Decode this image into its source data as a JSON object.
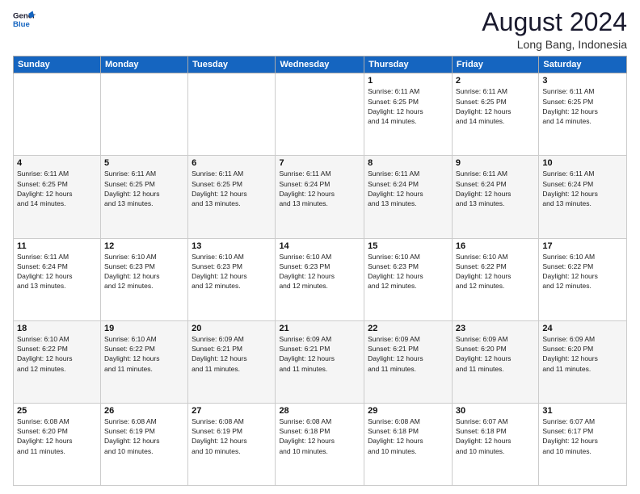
{
  "header": {
    "logo_line1": "General",
    "logo_line2": "Blue",
    "month_year": "August 2024",
    "location": "Long Bang, Indonesia"
  },
  "weekdays": [
    "Sunday",
    "Monday",
    "Tuesday",
    "Wednesday",
    "Thursday",
    "Friday",
    "Saturday"
  ],
  "weeks": [
    [
      {
        "day": "",
        "info": ""
      },
      {
        "day": "",
        "info": ""
      },
      {
        "day": "",
        "info": ""
      },
      {
        "day": "",
        "info": ""
      },
      {
        "day": "1",
        "info": "Sunrise: 6:11 AM\nSunset: 6:25 PM\nDaylight: 12 hours\nand 14 minutes."
      },
      {
        "day": "2",
        "info": "Sunrise: 6:11 AM\nSunset: 6:25 PM\nDaylight: 12 hours\nand 14 minutes."
      },
      {
        "day": "3",
        "info": "Sunrise: 6:11 AM\nSunset: 6:25 PM\nDaylight: 12 hours\nand 14 minutes."
      }
    ],
    [
      {
        "day": "4",
        "info": "Sunrise: 6:11 AM\nSunset: 6:25 PM\nDaylight: 12 hours\nand 14 minutes."
      },
      {
        "day": "5",
        "info": "Sunrise: 6:11 AM\nSunset: 6:25 PM\nDaylight: 12 hours\nand 13 minutes."
      },
      {
        "day": "6",
        "info": "Sunrise: 6:11 AM\nSunset: 6:25 PM\nDaylight: 12 hours\nand 13 minutes."
      },
      {
        "day": "7",
        "info": "Sunrise: 6:11 AM\nSunset: 6:24 PM\nDaylight: 12 hours\nand 13 minutes."
      },
      {
        "day": "8",
        "info": "Sunrise: 6:11 AM\nSunset: 6:24 PM\nDaylight: 12 hours\nand 13 minutes."
      },
      {
        "day": "9",
        "info": "Sunrise: 6:11 AM\nSunset: 6:24 PM\nDaylight: 12 hours\nand 13 minutes."
      },
      {
        "day": "10",
        "info": "Sunrise: 6:11 AM\nSunset: 6:24 PM\nDaylight: 12 hours\nand 13 minutes."
      }
    ],
    [
      {
        "day": "11",
        "info": "Sunrise: 6:11 AM\nSunset: 6:24 PM\nDaylight: 12 hours\nand 13 minutes."
      },
      {
        "day": "12",
        "info": "Sunrise: 6:10 AM\nSunset: 6:23 PM\nDaylight: 12 hours\nand 12 minutes."
      },
      {
        "day": "13",
        "info": "Sunrise: 6:10 AM\nSunset: 6:23 PM\nDaylight: 12 hours\nand 12 minutes."
      },
      {
        "day": "14",
        "info": "Sunrise: 6:10 AM\nSunset: 6:23 PM\nDaylight: 12 hours\nand 12 minutes."
      },
      {
        "day": "15",
        "info": "Sunrise: 6:10 AM\nSunset: 6:23 PM\nDaylight: 12 hours\nand 12 minutes."
      },
      {
        "day": "16",
        "info": "Sunrise: 6:10 AM\nSunset: 6:22 PM\nDaylight: 12 hours\nand 12 minutes."
      },
      {
        "day": "17",
        "info": "Sunrise: 6:10 AM\nSunset: 6:22 PM\nDaylight: 12 hours\nand 12 minutes."
      }
    ],
    [
      {
        "day": "18",
        "info": "Sunrise: 6:10 AM\nSunset: 6:22 PM\nDaylight: 12 hours\nand 12 minutes."
      },
      {
        "day": "19",
        "info": "Sunrise: 6:10 AM\nSunset: 6:22 PM\nDaylight: 12 hours\nand 11 minutes."
      },
      {
        "day": "20",
        "info": "Sunrise: 6:09 AM\nSunset: 6:21 PM\nDaylight: 12 hours\nand 11 minutes."
      },
      {
        "day": "21",
        "info": "Sunrise: 6:09 AM\nSunset: 6:21 PM\nDaylight: 12 hours\nand 11 minutes."
      },
      {
        "day": "22",
        "info": "Sunrise: 6:09 AM\nSunset: 6:21 PM\nDaylight: 12 hours\nand 11 minutes."
      },
      {
        "day": "23",
        "info": "Sunrise: 6:09 AM\nSunset: 6:20 PM\nDaylight: 12 hours\nand 11 minutes."
      },
      {
        "day": "24",
        "info": "Sunrise: 6:09 AM\nSunset: 6:20 PM\nDaylight: 12 hours\nand 11 minutes."
      }
    ],
    [
      {
        "day": "25",
        "info": "Sunrise: 6:08 AM\nSunset: 6:20 PM\nDaylight: 12 hours\nand 11 minutes."
      },
      {
        "day": "26",
        "info": "Sunrise: 6:08 AM\nSunset: 6:19 PM\nDaylight: 12 hours\nand 10 minutes."
      },
      {
        "day": "27",
        "info": "Sunrise: 6:08 AM\nSunset: 6:19 PM\nDaylight: 12 hours\nand 10 minutes."
      },
      {
        "day": "28",
        "info": "Sunrise: 6:08 AM\nSunset: 6:18 PM\nDaylight: 12 hours\nand 10 minutes."
      },
      {
        "day": "29",
        "info": "Sunrise: 6:08 AM\nSunset: 6:18 PM\nDaylight: 12 hours\nand 10 minutes."
      },
      {
        "day": "30",
        "info": "Sunrise: 6:07 AM\nSunset: 6:18 PM\nDaylight: 12 hours\nand 10 minutes."
      },
      {
        "day": "31",
        "info": "Sunrise: 6:07 AM\nSunset: 6:17 PM\nDaylight: 12 hours\nand 10 minutes."
      }
    ]
  ]
}
